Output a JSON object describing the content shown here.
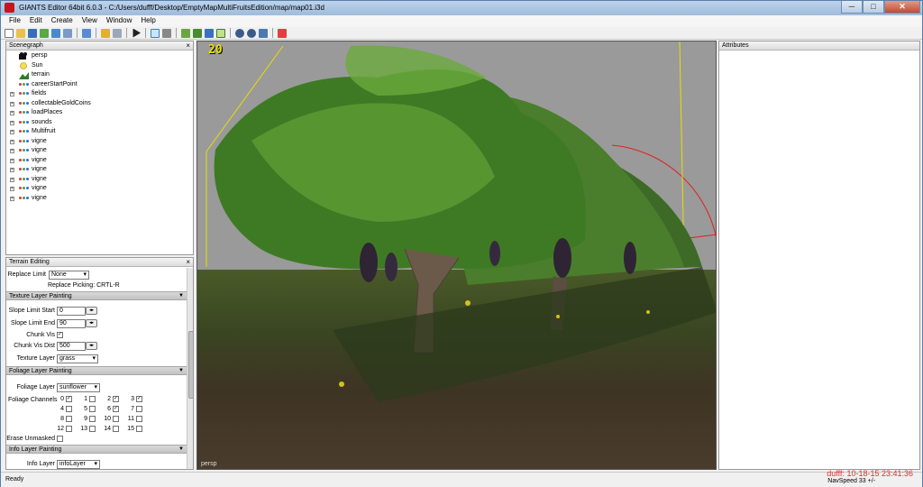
{
  "window": {
    "title": "GIANTS Editor 64bit 6.0.3 - C:/Users/dufff/Desktop/EmptyMapMultiFruitsEdition/map/map01.i3d",
    "minimize": "─",
    "maximize": "□",
    "close": "✕"
  },
  "menu": {
    "items": [
      "File",
      "Edit",
      "Create",
      "View",
      "Window",
      "Help"
    ]
  },
  "scenegraph": {
    "title": "Scenegraph",
    "close": "×",
    "items": [
      {
        "label": "persp",
        "icon": "camera-icon",
        "expandable": false
      },
      {
        "label": "Sun",
        "icon": "light-icon",
        "expandable": false
      },
      {
        "label": "terrain",
        "icon": "terrain-icon",
        "expandable": false
      },
      {
        "label": "careerStartPoint",
        "icon": "transform-group-icon",
        "expandable": false
      },
      {
        "label": "fields",
        "icon": "transform-group-icon",
        "expandable": true
      },
      {
        "label": "collectableGoldCoins",
        "icon": "transform-group-icon",
        "expandable": true
      },
      {
        "label": "loadPlaces",
        "icon": "transform-group-icon",
        "expandable": true
      },
      {
        "label": "sounds",
        "icon": "transform-group-icon",
        "expandable": true
      },
      {
        "label": "Multifruit",
        "icon": "transform-group-icon",
        "expandable": true
      },
      {
        "label": "vigne",
        "icon": "transform-group-icon",
        "expandable": true
      },
      {
        "label": "vigne",
        "icon": "transform-group-icon",
        "expandable": true
      },
      {
        "label": "vigne",
        "icon": "transform-group-icon",
        "expandable": true
      },
      {
        "label": "vigne",
        "icon": "transform-group-icon",
        "expandable": true
      },
      {
        "label": "vigne",
        "icon": "transform-group-icon",
        "expandable": true
      },
      {
        "label": "vigne",
        "icon": "transform-group-icon",
        "expandable": true
      },
      {
        "label": "vigne",
        "icon": "transform-group-icon",
        "expandable": true
      }
    ]
  },
  "terrain_editing": {
    "title": "Terrain Editing",
    "close": "×",
    "replace_limit_label": "Replace Limit",
    "replace_limit_value": "None",
    "replace_picking": "Replace Picking: CRTL-R",
    "texture_section": "Texture Layer Painting",
    "slope_start_label": "Slope Limit Start",
    "slope_start_value": "0",
    "slope_end_label": "Slope Limit End",
    "slope_end_value": "90",
    "chunk_vis_label": "Chunk Vis",
    "chunk_vis_dist_label": "Chunk Vis Dist",
    "chunk_vis_dist_value": "500",
    "texture_layer_label": "Texture Layer",
    "texture_layer_value": "grass",
    "foliage_section": "Foliage Layer Painting",
    "foliage_layer_label": "Foliage Layer",
    "foliage_layer_value": "sunflower",
    "foliage_channels_label": "Foliage Channels",
    "channels": [
      {
        "n": "0",
        "checked": true
      },
      {
        "n": "1",
        "checked": false
      },
      {
        "n": "2",
        "checked": true
      },
      {
        "n": "3",
        "checked": true
      },
      {
        "n": "4",
        "checked": false
      },
      {
        "n": "5",
        "checked": false
      },
      {
        "n": "6",
        "checked": true
      },
      {
        "n": "7",
        "checked": false
      },
      {
        "n": "8",
        "checked": false
      },
      {
        "n": "9",
        "checked": false
      },
      {
        "n": "10",
        "checked": false
      },
      {
        "n": "11",
        "checked": false
      },
      {
        "n": "12",
        "checked": false
      },
      {
        "n": "13",
        "checked": false
      },
      {
        "n": "14",
        "checked": false
      },
      {
        "n": "15",
        "checked": false
      }
    ],
    "erase_unmasked_label": "Erase Unmasked",
    "info_section": "Info Layer Painting",
    "info_layer_label": "Info Layer",
    "info_layer_value": "infoLayer",
    "stepper": "◂▸",
    "section_toggle": "▼",
    "check_mark": "✓"
  },
  "viewport": {
    "fps": "20",
    "camera": "persp"
  },
  "attributes": {
    "title": "Attributes"
  },
  "status": {
    "text": "Ready",
    "navspeed": "NavSpeed 33 +/-",
    "watermark": "dufff: 10-18-15 23:41:36"
  },
  "colors": {
    "titlebar": "#bcd3ec",
    "fps": "#e8e000",
    "gizmo_red": "#e02020",
    "gizmo_yellow": "#e6e000",
    "foliage": "#3e7a24"
  }
}
